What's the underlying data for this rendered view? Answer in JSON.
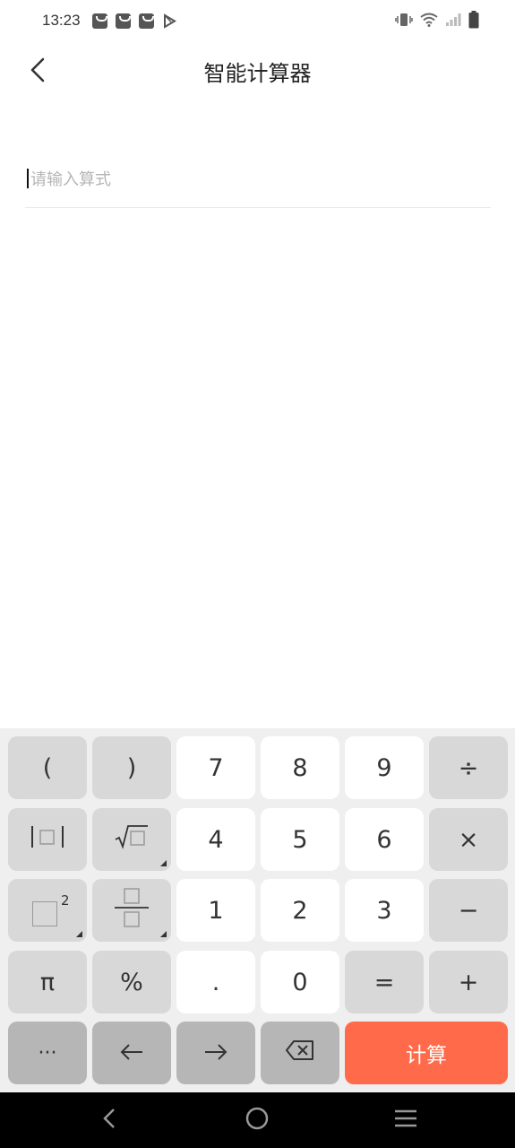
{
  "status_bar": {
    "time": "13:23",
    "notifications": [
      "shopping-bag-icon",
      "shopping-bag-icon",
      "shopping-bag-icon",
      "play-store-icon"
    ],
    "right_icons": [
      "vibrate-icon",
      "wifi-icon",
      "signal-icon",
      "battery-icon"
    ]
  },
  "header": {
    "title": "智能计算器",
    "back_icon": "back-arrow-icon"
  },
  "input": {
    "value": "",
    "placeholder": "请输入算式"
  },
  "keyboard": {
    "row1": [
      "(",
      ")",
      "7",
      "8",
      "9",
      "÷"
    ],
    "row2": [
      "abs",
      "sqrt",
      "4",
      "5",
      "6",
      "×"
    ],
    "row3": [
      "square",
      "fraction",
      "1",
      "2",
      "3",
      "−"
    ],
    "row4": [
      "π",
      "%",
      ".",
      "0",
      "=",
      "+"
    ],
    "row5": [
      "···",
      "←",
      "→",
      "backspace",
      "计算"
    ],
    "square_exponent": "2",
    "calc_color": "#ff6b4a"
  },
  "nav_bar": {
    "icons": [
      "nav-back-icon",
      "home-icon",
      "menu-icon"
    ]
  }
}
